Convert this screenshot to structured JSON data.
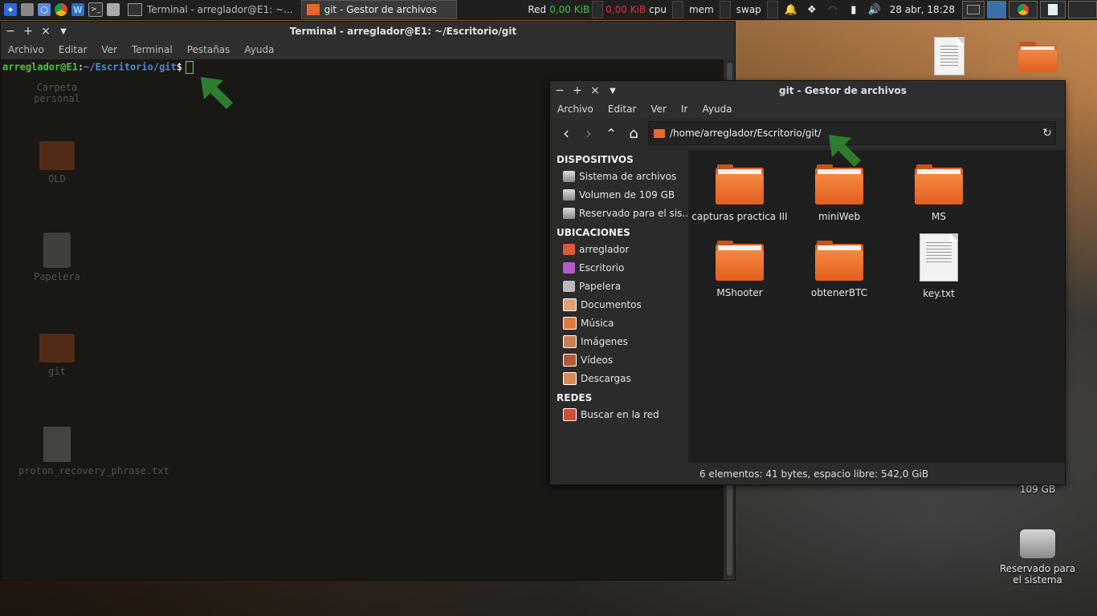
{
  "panel": {
    "tasks": [
      {
        "label": "Terminal - arreglador@E1: ~..."
      },
      {
        "label": "git - Gestor de archivos"
      }
    ],
    "net_label": "Red",
    "net_down": "0,00",
    "net_down_unit": "KiB",
    "net_up": "0,00",
    "net_up_unit": "KiB",
    "cpu_label": "cpu",
    "mem_label": "mem",
    "swap_label": "swap",
    "clock": "28 abr, 18:28"
  },
  "desktop": {
    "icons": [
      {
        "label": "109 GB"
      },
      {
        "label": "Reservado para el sistema"
      }
    ],
    "ghost_icons": [
      {
        "label": "Carpeta personal"
      },
      {
        "label": "OLD"
      },
      {
        "label": "Papelera"
      },
      {
        "label": "git"
      },
      {
        "label": "proton_recovery_phrase.txt"
      }
    ]
  },
  "terminal": {
    "title": "Terminal - arreglador@E1: ~/Escritorio/git",
    "menu": [
      "Archivo",
      "Editar",
      "Ver",
      "Terminal",
      "Pestañas",
      "Ayuda"
    ],
    "prompt_user": "arreglador@E1",
    "prompt_sep": ":",
    "prompt_path": "~/Escritorio/git",
    "prompt_dollar": "$"
  },
  "file_manager": {
    "title": "git - Gestor de archivos",
    "menu": [
      "Archivo",
      "Editar",
      "Ver",
      "Ir",
      "Ayuda"
    ],
    "location": "/home/arreglador/Escritorio/git/",
    "sections": [
      {
        "title": "DISPOSITIVOS",
        "items": [
          "Sistema de archivos",
          "Volumen de 109 GB",
          "Reservado para el sis..."
        ]
      },
      {
        "title": "UBICACIONES",
        "items": [
          "arreglador",
          "Escritorio",
          "Papelera",
          "Documentos",
          "Música",
          "Imágenes",
          "Vídeos",
          "Descargas"
        ]
      },
      {
        "title": "REDES",
        "items": [
          "Buscar en la red"
        ]
      }
    ],
    "files": [
      {
        "name": "capturas practica III",
        "type": "folder"
      },
      {
        "name": "miniWeb",
        "type": "folder"
      },
      {
        "name": "MS",
        "type": "folder"
      },
      {
        "name": "MShooter",
        "type": "folder"
      },
      {
        "name": "obtenerBTC",
        "type": "folder"
      },
      {
        "name": "key.txt",
        "type": "text"
      }
    ],
    "status": "6 elementos: 41 bytes, espacio libre: 542,0 GiB"
  },
  "colors": {
    "folder": "#e8652b",
    "prompt_user": "#4fc24f",
    "prompt_path": "#4a8cdb",
    "arrow": "#2e7d2e"
  }
}
